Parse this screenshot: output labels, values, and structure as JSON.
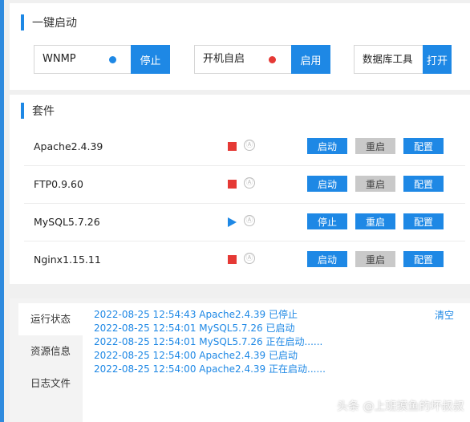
{
  "quick_start": {
    "title": "一键启动",
    "items": [
      {
        "label": "WNMP",
        "button": "停止",
        "status_color": "#1e88e5"
      },
      {
        "label": "开机自启",
        "button": "启用",
        "status_color": "#e53935"
      },
      {
        "label": "数据库工具",
        "button": "打开"
      }
    ]
  },
  "suite": {
    "title": "套件",
    "auto_symbol": "Ⓐ",
    "rows": [
      {
        "name": "Apache2.4.39",
        "state": "stopped",
        "start_label": "启动",
        "restart_label": "重启",
        "config_label": "配置"
      },
      {
        "name": "FTP0.9.60",
        "state": "stopped",
        "start_label": "启动",
        "restart_label": "重启",
        "config_label": "配置"
      },
      {
        "name": "MySQL5.7.26",
        "state": "running",
        "start_label": "停止",
        "restart_label": "重启",
        "config_label": "配置"
      },
      {
        "name": "Nginx1.15.11",
        "state": "stopped",
        "start_label": "启动",
        "restart_label": "重启",
        "config_label": "配置"
      }
    ]
  },
  "status_panel": {
    "tabs": [
      "运行状态",
      "资源信息",
      "日志文件"
    ],
    "active_tab": 0,
    "clear_label": "清空",
    "log": [
      "2022-08-25 12:54:43 Apache2.4.39 已停止",
      "2022-08-25 12:54:01 MySQL5.7.26 已启动",
      "2022-08-25 12:54:01 MySQL5.7.26 正在启动......",
      "2022-08-25 12:54:00 Apache2.4.39 已启动",
      "2022-08-25 12:54:00 Apache2.4.39 正在启动......"
    ]
  },
  "watermark": "头条 @上班摸鱼的坏叔叔",
  "colors": {
    "accent": "#1e88e5",
    "stop": "#e53935",
    "disabled": "#c9c9c9"
  }
}
